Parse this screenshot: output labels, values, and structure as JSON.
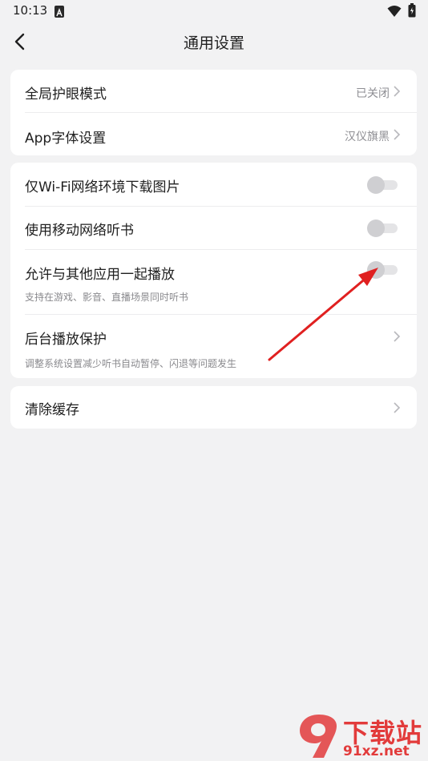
{
  "status_bar": {
    "time": "10:13",
    "notification_icon": "a-notification-icon",
    "wifi_icon": "wifi-icon",
    "battery_icon": "battery-icon"
  },
  "header": {
    "back_icon": "chevron-left-icon",
    "title": "通用设置"
  },
  "display_card": {
    "rows": [
      {
        "title": "全局护眼模式",
        "value": "已关闭"
      },
      {
        "title": "App字体设置",
        "value": "汉仪旗黑"
      }
    ]
  },
  "playback_card": {
    "rows": [
      {
        "title": "仅Wi-Fi网络环境下载图片",
        "toggle": false
      },
      {
        "title": "使用移动网络听书",
        "toggle": false
      },
      {
        "title": "允许与其他应用一起播放",
        "subtitle": "支持在游戏、影音、直播场景同时听书",
        "toggle": false
      },
      {
        "title": "后台播放保护",
        "subtitle": "调整系统设置减少听书自动暂停、闪退等问题发生"
      }
    ]
  },
  "cache_card": {
    "title": "清除缓存"
  },
  "annotation": {
    "arrow_color": "#e02020"
  },
  "watermark": {
    "logo": "9",
    "text_top": "下载站",
    "text_bottom": "91xz.net"
  },
  "colors": {
    "background": "#f2f2f3",
    "card": "#ffffff",
    "toggle_off_thumb": "#cfcfd2",
    "toggle_off_track": "#e4e4e6",
    "secondary_text": "#8e8e93"
  }
}
